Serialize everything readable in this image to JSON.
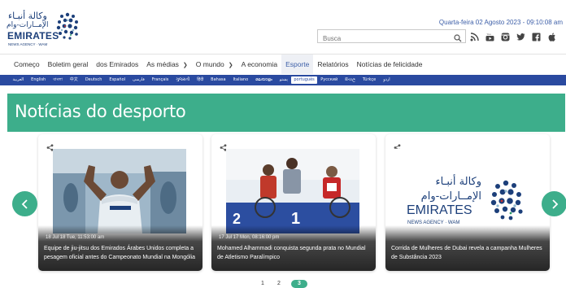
{
  "header": {
    "logo": {
      "arabic_line1": "وكالة أنبـاء",
      "arabic_line2": "الإمــارات-وام",
      "english": "EMIRATES",
      "subtitle": "NEWS AGENCY · WAM"
    },
    "date_text": "Quarta-feira 02 Agosto 2023 - 09:10:08 am",
    "search": {
      "placeholder": "Busca"
    },
    "social": [
      "search-icon",
      "rss-icon",
      "youtube-icon",
      "instagram-icon",
      "twitter-icon",
      "facebook-icon",
      "apple-icon"
    ]
  },
  "nav": {
    "items": [
      {
        "label": "Começo",
        "dropdown": false
      },
      {
        "label": "Boletim geral",
        "dropdown": false
      },
      {
        "label": "dos Emirados",
        "dropdown": false
      },
      {
        "label": "As médias",
        "dropdown": true
      },
      {
        "label": "O mundo",
        "dropdown": true
      },
      {
        "label": "A economia",
        "dropdown": false
      },
      {
        "label": "Esporte",
        "dropdown": false,
        "active": true
      },
      {
        "label": "Relatórios",
        "dropdown": false
      },
      {
        "label": "Notícias de felicidade",
        "dropdown": false
      }
    ]
  },
  "languages": {
    "items": [
      "العربية",
      "English",
      "বাংলা",
      "中文",
      "Deutsch",
      "Español",
      "فارسی",
      "Français",
      "ગુજરાતી",
      "हिंदी",
      "Bahasa",
      "Italiano",
      "മലയാളം",
      "پښتو",
      "português",
      "Русский",
      "සිංහල",
      "Türkçe",
      "اردو"
    ],
    "selected": "português"
  },
  "section": {
    "title": "Notícias do desporto"
  },
  "cards": [
    {
      "meta": "18 Jul 18 Tue, 11:53:00 am",
      "title": "Equipe de jiu-jitsu dos Emirados Árabes Unidos completa a pesagem oficial antes do Campeonato Mundial na Mongólia"
    },
    {
      "meta": "17 Jul 17 Mon, 08:16:00 pm",
      "title": "Mohamed Alhammadi conquista segunda prata no Mundial de Atletismo Paralímpico"
    },
    {
      "meta": "",
      "title": "Corrida de Mulheres de Dubai revela a campanha Mulheres de Substância 2023"
    }
  ],
  "pager": {
    "pages": [
      "1",
      "2",
      "3"
    ],
    "current": "3"
  },
  "colors": {
    "accent": "#3dae8b",
    "brand_blue": "#2a4aa0",
    "logo_navy": "#1c3f7a"
  }
}
